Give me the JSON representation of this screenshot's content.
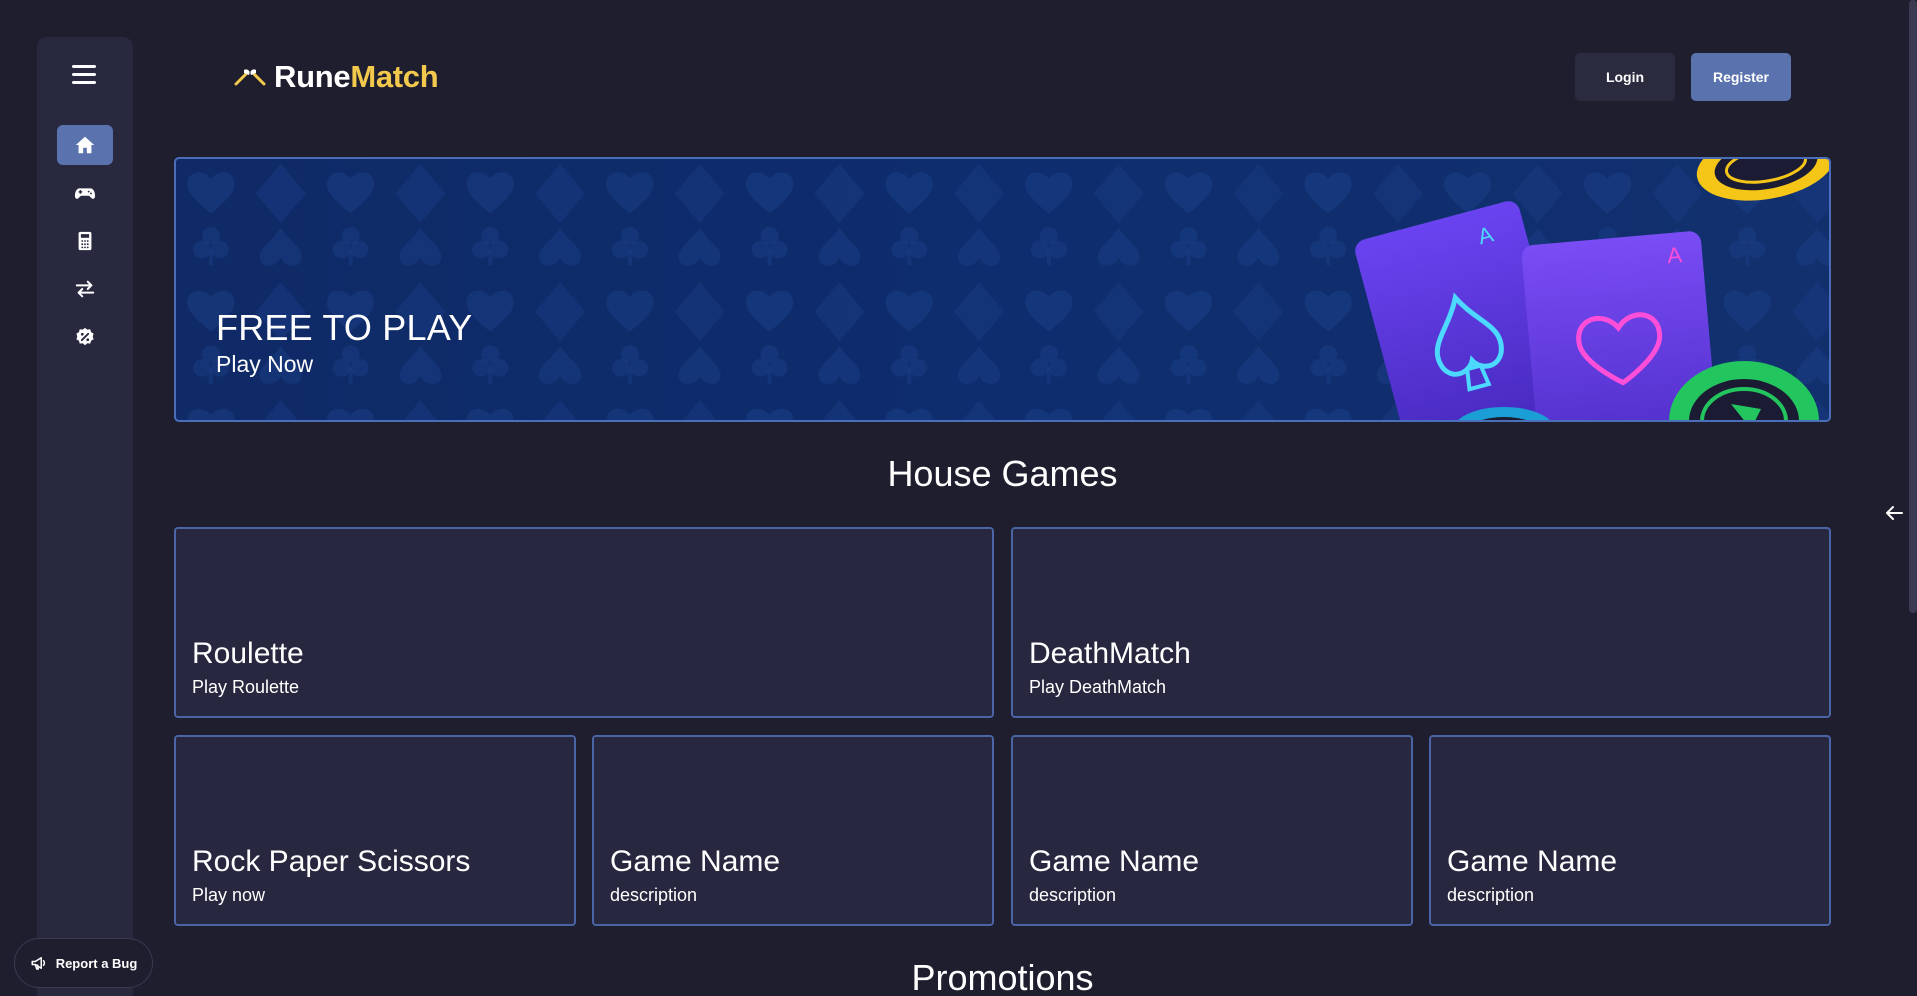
{
  "sidebar": {
    "menu_icon": "hamburger-icon",
    "items": [
      {
        "icon": "home-icon",
        "active": true
      },
      {
        "icon": "gamepad-icon",
        "active": false
      },
      {
        "icon": "calculator-icon",
        "active": false
      },
      {
        "icon": "exchange-arrows-icon",
        "active": false
      },
      {
        "icon": "discount-badge-icon",
        "active": false
      }
    ]
  },
  "header": {
    "logo_part1": "Rune",
    "logo_part2": "Match",
    "login_label": "Login",
    "register_label": "Register"
  },
  "banner": {
    "title": "FREE TO PLAY",
    "subtitle": "Play Now"
  },
  "house_games": {
    "title": "House Games",
    "games": [
      {
        "title": "Roulette",
        "desc": "Play Roulette"
      },
      {
        "title": "DeathMatch",
        "desc": "Play DeathMatch"
      },
      {
        "title": "Rock Paper Scissors",
        "desc": "Play now"
      },
      {
        "title": "Game Name",
        "desc": "description"
      },
      {
        "title": "Game Name",
        "desc": "description"
      },
      {
        "title": "Game Name",
        "desc": "description"
      }
    ]
  },
  "promotions": {
    "title": "Promotions"
  },
  "report_bug": {
    "label": "Report a Bug"
  },
  "colors": {
    "background": "#1e1e2e",
    "sidebar": "#28283f",
    "accent": "#5a72ad",
    "brand_yellow": "#f2c94c",
    "card": "#27273f",
    "card_border": "#4a64a6"
  }
}
